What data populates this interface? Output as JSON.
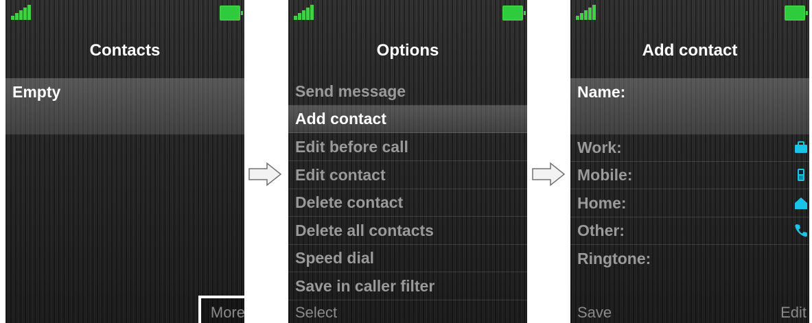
{
  "screens": [
    {
      "title": "Contacts",
      "list": [
        "Empty"
      ],
      "softkey_right": "More"
    },
    {
      "title": "Options",
      "menu": [
        "Send message",
        "Add contact",
        "Edit before call",
        "Edit contact",
        "Delete contact",
        "Delete all contacts",
        "Speed dial",
        "Save in caller filter"
      ],
      "selected_index": 1,
      "softkey_left": "Select"
    },
    {
      "title": "Add contact",
      "fields": [
        "Name:",
        "Work:",
        "Mobile:",
        "Home:",
        "Other:",
        "Ringtone:"
      ],
      "field_icons": [
        "briefcase-icon",
        "mobile-phone-icon",
        "house-icon",
        "handset-icon"
      ],
      "softkey_left": "Save",
      "softkey_right": "Edit"
    }
  ],
  "colors": {
    "signal": "#3fd046",
    "battery": "#2ecb3c",
    "field_icon": "#19c4e8",
    "dim_text": "#9a9a9a"
  }
}
